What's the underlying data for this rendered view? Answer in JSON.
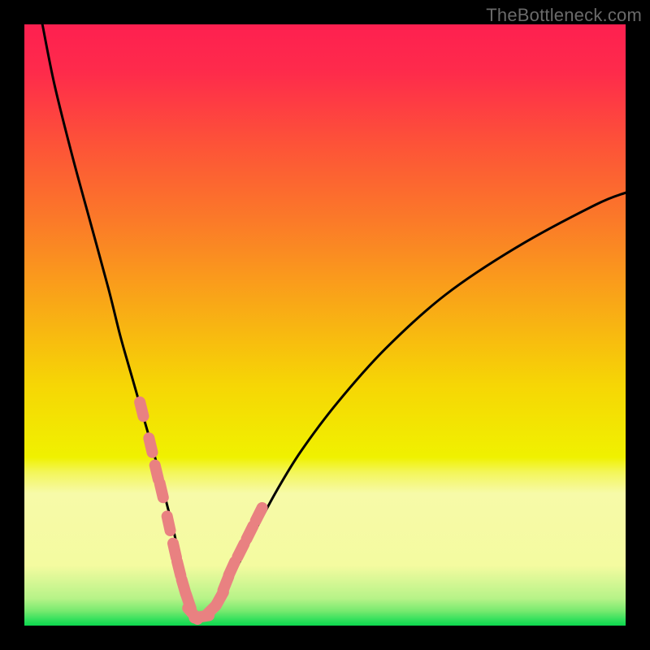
{
  "watermark": "TheBottleneck.com",
  "colors": {
    "frame": "#000000",
    "curve_stroke": "#000000",
    "marker_fill": "#e98181",
    "gradient_stops": [
      {
        "offset": 0.0,
        "color": "#fe2050"
      },
      {
        "offset": 0.08,
        "color": "#fe2b4b"
      },
      {
        "offset": 0.2,
        "color": "#fd5338"
      },
      {
        "offset": 0.33,
        "color": "#fb7b28"
      },
      {
        "offset": 0.47,
        "color": "#f9aa16"
      },
      {
        "offset": 0.6,
        "color": "#f6d605"
      },
      {
        "offset": 0.72,
        "color": "#f0f100"
      },
      {
        "offset": 0.745,
        "color": "#f3f65a"
      },
      {
        "offset": 0.78,
        "color": "#f7faa8"
      },
      {
        "offset": 0.9,
        "color": "#f4fba0"
      },
      {
        "offset": 0.955,
        "color": "#b6f388"
      },
      {
        "offset": 0.975,
        "color": "#7aea70"
      },
      {
        "offset": 0.99,
        "color": "#33e05c"
      },
      {
        "offset": 1.0,
        "color": "#0cd84e"
      }
    ]
  },
  "chart_data": {
    "type": "line",
    "title": "",
    "xlabel": "",
    "ylabel": "",
    "xlim": [
      0,
      100
    ],
    "ylim": [
      0,
      100
    ],
    "series": [
      {
        "name": "bottleneck-curve",
        "x": [
          3,
          5,
          8,
          11,
          14,
          16,
          18,
          20,
          22,
          23.5,
          25,
          26,
          27,
          27.8,
          28.5,
          30,
          32,
          34,
          36,
          38.5,
          42,
          46,
          52,
          60,
          70,
          82,
          95,
          100
        ],
        "y": [
          100,
          90,
          78,
          67,
          56,
          48,
          41,
          34,
          27,
          21,
          15,
          10,
          6,
          3,
          1.5,
          1.5,
          3.5,
          7,
          11,
          16,
          22.5,
          29,
          37,
          46,
          55,
          63,
          70,
          72
        ]
      }
    ],
    "markers": {
      "name": "highlighted-points",
      "x": [
        19.5,
        21.0,
        22.0,
        22.8,
        24.0,
        25.0,
        25.7,
        26.5,
        27.3,
        28.0,
        29.5,
        31.0,
        32.5,
        33.5,
        34.5,
        36.0,
        37.5,
        39.0
      ],
      "y": [
        36.0,
        30.0,
        25.5,
        22.5,
        17.0,
        12.5,
        9.5,
        6.5,
        4.0,
        2.0,
        1.5,
        2.5,
        4.5,
        7.0,
        9.5,
        12.5,
        15.5,
        18.5
      ]
    }
  }
}
